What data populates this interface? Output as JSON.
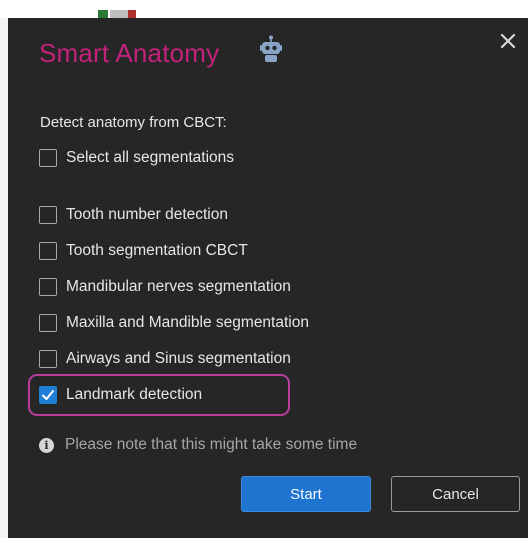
{
  "dialog": {
    "title": "Smart Anatomy",
    "robot_icon": "robot-icon",
    "close_icon": "close-icon",
    "heading": "Detect anatomy from CBCT:",
    "select_all": {
      "label": "Select all segmentations",
      "checked": false
    },
    "options": [
      {
        "label": "Tooth number detection",
        "checked": false
      },
      {
        "label": "Tooth segmentation CBCT",
        "checked": false
      },
      {
        "label": "Mandibular nerves segmentation",
        "checked": false
      },
      {
        "label": "Maxilla and Mandible segmentation",
        "checked": false
      },
      {
        "label": "Airways and Sinus segmentation",
        "checked": false
      },
      {
        "label": "Landmark detection",
        "checked": true
      }
    ],
    "note": {
      "icon": "info-icon",
      "text": "Please note that this might take some time"
    },
    "buttons": {
      "start": "Start",
      "cancel": "Cancel"
    },
    "colors": {
      "title": "#c3227a",
      "background": "#262626",
      "accent": "#1f74d0",
      "highlight": "#b83d9a"
    }
  }
}
